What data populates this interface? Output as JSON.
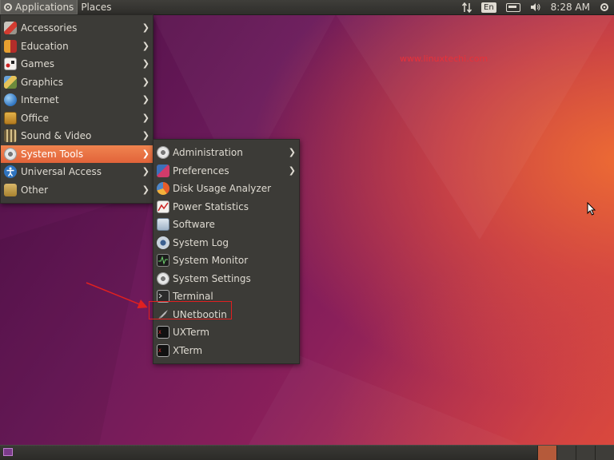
{
  "top_panel": {
    "applications_label": "Applications",
    "places_label": "Places",
    "keyboard_layout": "En",
    "clock": "8:28 AM"
  },
  "watermark": "www.linuxtechi.com",
  "main_menu": {
    "items": [
      {
        "label": "Accessories",
        "icon": "accessories-icon",
        "submenu": true
      },
      {
        "label": "Education",
        "icon": "education-icon",
        "submenu": true
      },
      {
        "label": "Games",
        "icon": "games-icon",
        "submenu": true
      },
      {
        "label": "Graphics",
        "icon": "graphics-icon",
        "submenu": true
      },
      {
        "label": "Internet",
        "icon": "internet-icon",
        "submenu": true
      },
      {
        "label": "Office",
        "icon": "office-icon",
        "submenu": true
      },
      {
        "label": "Sound & Video",
        "icon": "sound-video-icon",
        "submenu": true
      },
      {
        "label": "System Tools",
        "icon": "system-tools-icon",
        "submenu": true,
        "active": true
      },
      {
        "label": "Universal Access",
        "icon": "universal-access-icon",
        "submenu": true
      },
      {
        "label": "Other",
        "icon": "other-icon",
        "submenu": true
      }
    ]
  },
  "system_tools_menu": {
    "items": [
      {
        "label": "Administration",
        "icon": "administration-icon",
        "submenu": true
      },
      {
        "label": "Preferences",
        "icon": "preferences-icon",
        "submenu": true
      },
      {
        "label": "Disk Usage Analyzer",
        "icon": "disk-usage-icon"
      },
      {
        "label": "Power Statistics",
        "icon": "power-statistics-icon"
      },
      {
        "label": "Software",
        "icon": "software-icon"
      },
      {
        "label": "System Log",
        "icon": "system-log-icon"
      },
      {
        "label": "System Monitor",
        "icon": "system-monitor-icon"
      },
      {
        "label": "System Settings",
        "icon": "system-settings-icon"
      },
      {
        "label": "Terminal",
        "icon": "terminal-icon"
      },
      {
        "label": "UNetbootin",
        "icon": "unetbootin-icon",
        "highlighted": true
      },
      {
        "label": "UXTerm",
        "icon": "uxterm-icon"
      },
      {
        "label": "XTerm",
        "icon": "xterm-icon"
      }
    ]
  },
  "colors": {
    "menu_bg": "#3c3b37",
    "active_item": "#e95f30",
    "highlight_box": "#e02020",
    "watermark": "#e8313a"
  }
}
